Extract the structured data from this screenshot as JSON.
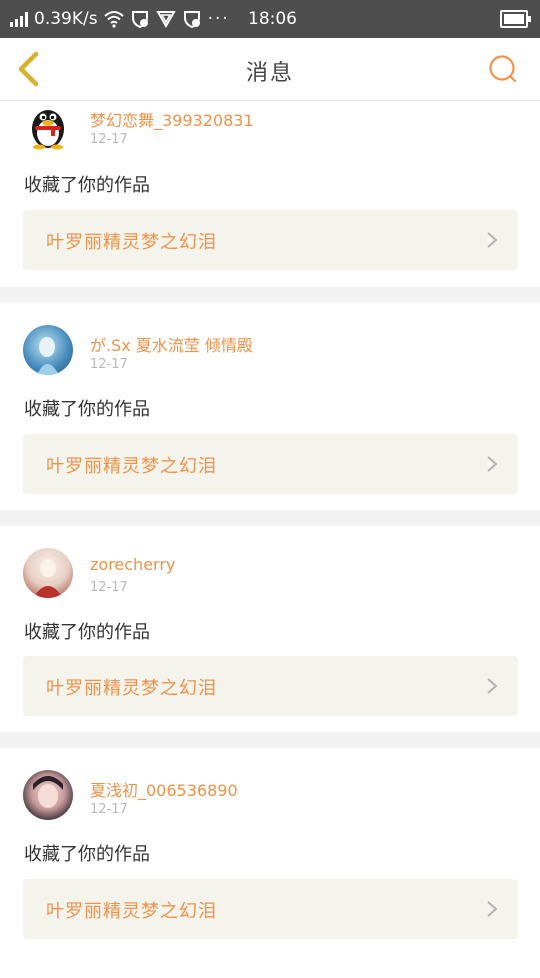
{
  "status_bar": {
    "speed": "0.39K/s",
    "time": "18:06",
    "icons": [
      "signal-icon",
      "wifi-icon",
      "shield-icon",
      "vpn-icon",
      "sync-icon",
      "more-icon",
      "battery-icon"
    ]
  },
  "nav": {
    "title": "消息",
    "back_icon": "chevron-left-icon",
    "search_icon": "search-icon",
    "accent": "#f0924a"
  },
  "messages": [
    {
      "user": "梦幻恋舞_399320831",
      "date": "12-17",
      "action": "收藏了你的作品",
      "work": "叶罗丽精灵梦之幻泪",
      "avatar": "qq-penguin-avatar"
    },
    {
      "user": "が.Sx 夏水流莹 倾情殿",
      "date": "12-17",
      "action": "收藏了你的作品",
      "work": "叶罗丽精灵梦之幻泪",
      "avatar": "anime-girl-blue-avatar"
    },
    {
      "user": "zorecherry",
      "date": "12-17",
      "action": "收藏了你的作品",
      "work": "叶罗丽精灵梦之幻泪",
      "avatar": "anime-girl-red-avatar"
    },
    {
      "user": "夏浅初_006536890",
      "date": "12-17",
      "action": "收藏了你的作品",
      "work": "叶罗丽精灵梦之幻泪",
      "avatar": "girl-photo-avatar"
    }
  ]
}
